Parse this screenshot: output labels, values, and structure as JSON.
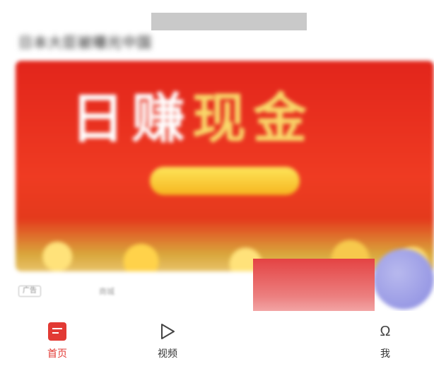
{
  "feed": {
    "headline": "日本大臣被曝光中国",
    "ad": {
      "banner_text_white": "日赚",
      "banner_text_gold": "现金",
      "tag_label": "广告",
      "source_label": "商城"
    }
  },
  "tabbar": {
    "items": [
      {
        "label": "首页",
        "icon": "home-icon",
        "active": true
      },
      {
        "label": "视频",
        "icon": "play-icon",
        "active": false
      },
      {
        "label": "我",
        "icon": "person-icon",
        "active": false
      }
    ],
    "active_color": "#e23a34"
  }
}
